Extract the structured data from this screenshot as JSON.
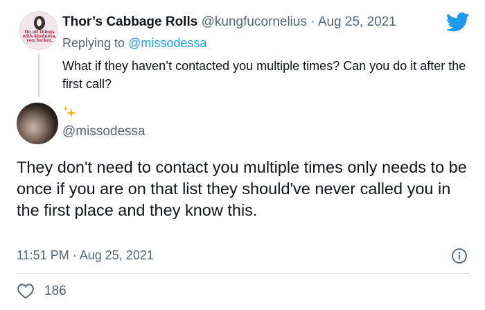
{
  "parent_tweet": {
    "author_name": "Thor’s Cabbage Rolls",
    "author_handle": "@kungfucornelius",
    "separator": "·",
    "date": "Aug 25, 2021",
    "avatar_caption": "Do all things with kindness, you fucker.",
    "replying_to_prefix": "Replying to",
    "replying_to_handle": "@missodessa",
    "text": "What if they haven’t contacted you multiple times? Can you do it after the first call?"
  },
  "main_tweet": {
    "author_name_icon": "sparkles-icon",
    "author_handle": "@missodessa",
    "text": "They don't need to contact you multiple times only needs to be once if you are on that list they should've never called you in the first place and they know this.",
    "time": "11:51 PM",
    "separator": "·",
    "date": "Aug 25, 2021",
    "likes": "186"
  },
  "icons": {
    "brand": "twitter-bird-icon",
    "info": "info-icon",
    "like": "heart-icon"
  },
  "colors": {
    "brand_blue": "#1d9bf0",
    "text_primary": "#0f1419",
    "text_secondary": "#536471",
    "sparkle": "#f4b400",
    "divider": "#cfd9de"
  }
}
